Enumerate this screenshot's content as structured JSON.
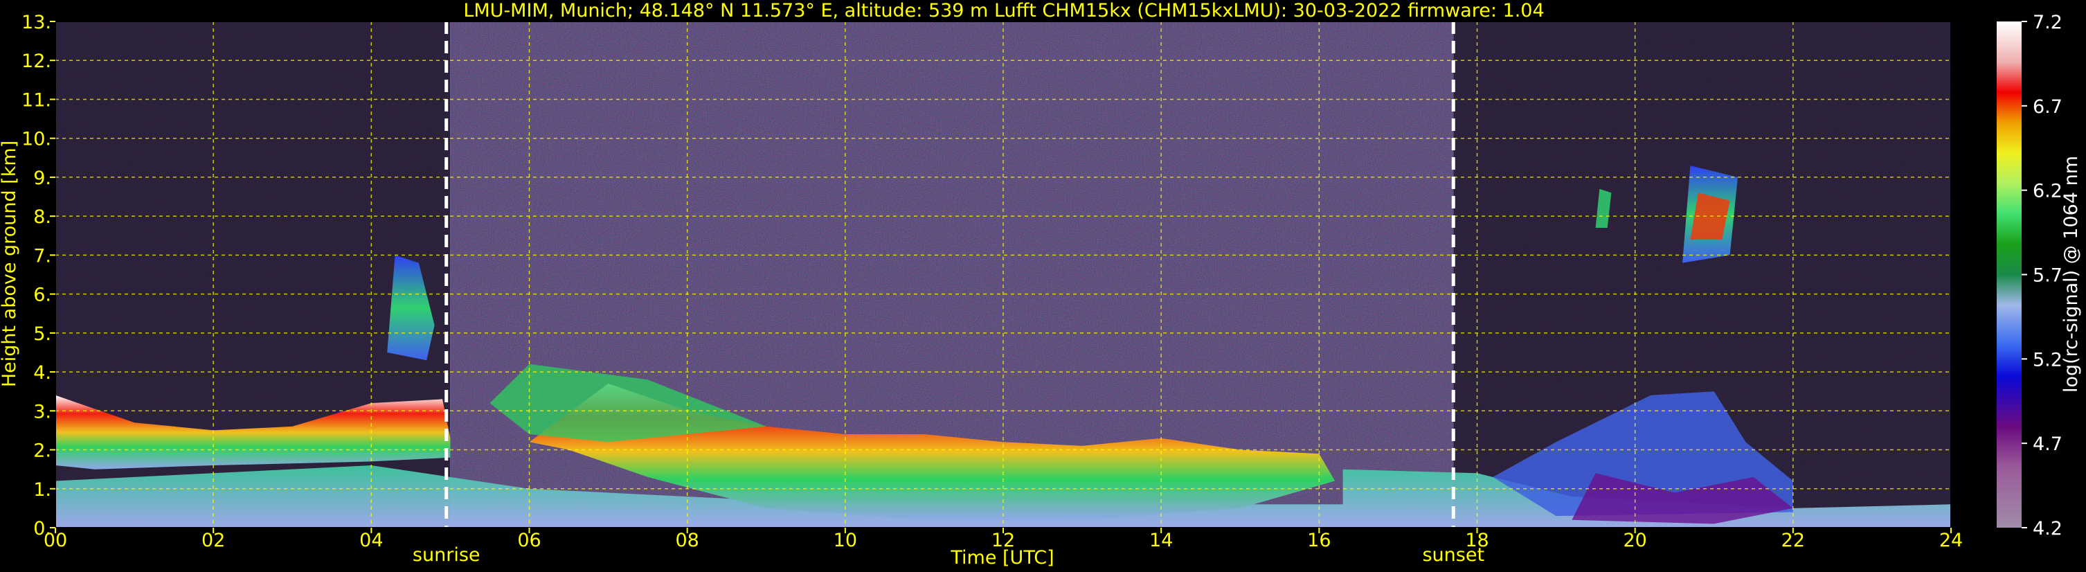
{
  "chart_data": {
    "type": "heatmap",
    "title": "LMU-MIM, Munich; 48.148° N 11.573° E, altitude: 539 m    Lufft CHM15kx (CHM15kxLMU): 30-03-2022    firmware: 1.04",
    "xlabel": "Time [UTC]",
    "ylabel": "Height above ground [km]",
    "xlim": [
      0,
      24
    ],
    "ylim": [
      0,
      13
    ],
    "x_ticks": [
      "00",
      "02",
      "04",
      "06",
      "08",
      "10",
      "12",
      "14",
      "16",
      "18",
      "20",
      "22",
      "24"
    ],
    "y_ticks": [
      "0.",
      "1.",
      "2.",
      "3.",
      "4.",
      "5.",
      "6.",
      "7.",
      "8.",
      "9.",
      "10.",
      "11.",
      "12.",
      "13."
    ],
    "grid": true,
    "colorbar": {
      "label": "log(rc-signal) @ 1064 nm",
      "range": [
        4.2,
        7.2
      ],
      "ticks": [
        "4.2",
        "4.7",
        "5.2",
        "5.7",
        "6.2",
        "6.7",
        "7.2"
      ]
    },
    "annotations": [
      {
        "label": "sunrise",
        "time": 4.95
      },
      {
        "label": "sunset",
        "time": 17.7
      }
    ],
    "colors": {
      "background": "#000000",
      "text": "#ffff00",
      "grid": "#ffff00",
      "marker_lines": "#ffffff"
    }
  }
}
